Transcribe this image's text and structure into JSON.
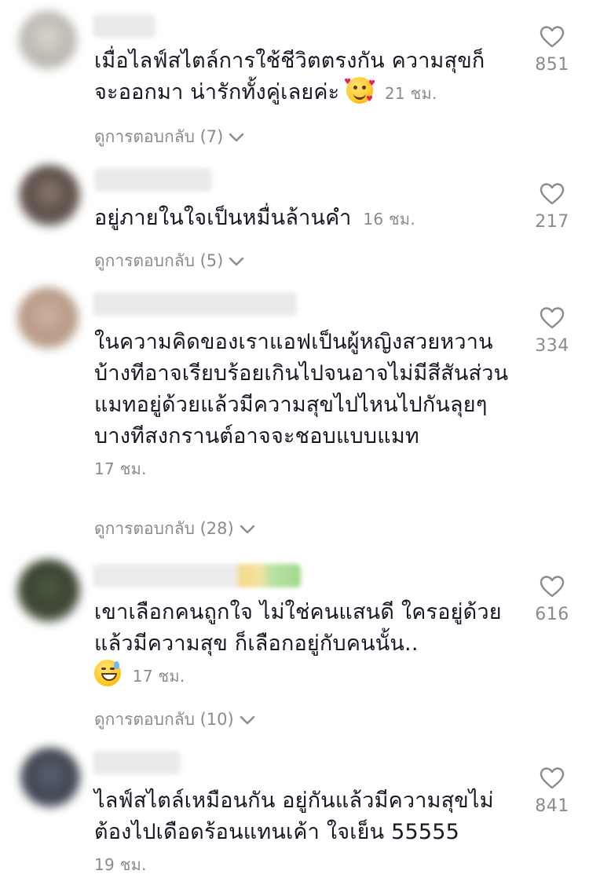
{
  "comments": [
    {
      "text": "เมื่อไลฟ์สไตล์การใช้ชีวิตตรงกัน ความสุขก็จะออกมา น่ารักทั้งคู่เลยค่ะ",
      "emoji": "smiling-face-with-hearts",
      "time": "21 ชม.",
      "replies": "ดูการตอบกลับ (7)",
      "likes": "851"
    },
    {
      "text": "อยู่ภายในใจเป็นหมื่นล้านคำ",
      "time": "16 ชม.",
      "replies": "ดูการตอบกลับ (5)",
      "likes": "217"
    },
    {
      "text": "ในความคิดของเราแอฟเป็นผู้หญิงสวยหวานบ้างทีอาจเรียบร้อยเกินไปจนอาจไม่มีสีสันส่วนแมทอยู่ด้วยแล้วมีความสุขไปไหนไปกันลุยๆบางทีสงกรานต์อาจจะชอบแบบแมท",
      "time": "17 ชม.",
      "replies": "ดูการตอบกลับ (28)",
      "likes": "334"
    },
    {
      "text": "เขาเลือกคนถูกใจ ไม่ใช่คนแสนดี ใครอยู่ด้วยแล้วมีความสุข ก็เลือกอยู่กับคนนั้น..",
      "emoji": "grinning-face-with-sweat",
      "time": "17 ชม.",
      "replies": "ดูการตอบกลับ (10)",
      "likes": "616"
    },
    {
      "text": "ไลฟ์สไตล์เหมือนกัน อยู่กันแล้วมีความสุขไม่ต้องไปเดือดร้อนแทนเค้า ใจเย็น 55555",
      "time": "19 ชม.",
      "likes": "841"
    }
  ],
  "colors": {
    "text": "#161823",
    "muted": "#8a8b91",
    "background": "#ffffff"
  },
  "icons": {
    "like": "heart-outline-icon",
    "expand": "chevron-down-icon"
  }
}
